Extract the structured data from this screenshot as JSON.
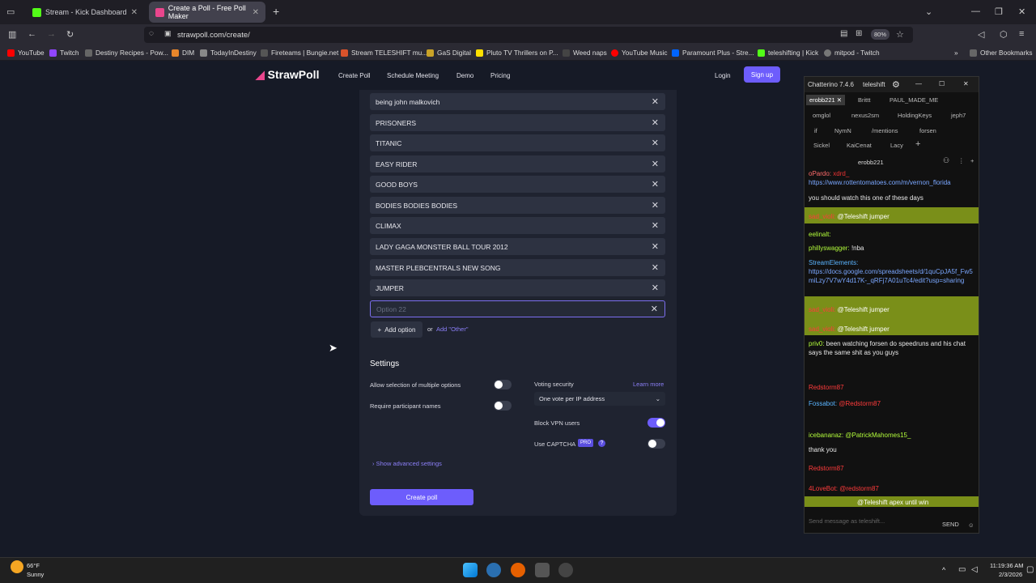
{
  "browser": {
    "tabs": [
      {
        "title": "Stream - Kick Dashboard",
        "active": false
      },
      {
        "title": "Create a Poll - Free Poll Maker",
        "active": true
      }
    ],
    "url": "strawpoll.com/create/",
    "zoom": "80%",
    "bookmarks": [
      "YouTube",
      "Twitch",
      "Destiny Recipes - Pow...",
      "DIM",
      "TodayInDestiny",
      "Fireteams | Bungie.net",
      "Stream TELESHIFT mu...",
      "GaS Digital",
      "Pluto TV Thrillers on P...",
      "Weed naps",
      "YouTube Music",
      "Paramount Plus - Stre...",
      "teleshifting | Kick",
      "mitpod - Twitch"
    ],
    "other_bookmarks": "Other Bookmarks"
  },
  "site": {
    "logo": "StrawPoll",
    "nav": [
      "Create Poll",
      "Schedule Meeting",
      "Demo",
      "Pricing"
    ],
    "login": "Login",
    "signup": "Sign up"
  },
  "poll": {
    "options": [
      "being john malkovich",
      "PRISONERS",
      "TITANIC",
      "EASY RIDER",
      "GOOD BOYS",
      "BODIES BODIES BODIES",
      "CLIMAX",
      "LADY GAGA MONSTER BALL TOUR 2012",
      "MASTER PLEBCENTRALS NEW SONG",
      "JUMPER"
    ],
    "new_option_placeholder": "Option 22",
    "add_option": "Add option",
    "or": "or",
    "add_other": "Add \"Other\""
  },
  "settings": {
    "title": "Settings",
    "multiple": "Allow selection of multiple options",
    "names": "Require participant names",
    "voting_security": "Voting security",
    "learn_more": "Learn more",
    "security_value": "One vote per IP address",
    "block_vpn": "Block VPN users",
    "captcha": "Use CAPTCHA",
    "pro": "PRO",
    "advanced": "Show advanced settings",
    "create": "Create poll"
  },
  "chat": {
    "app": "Chatterino 7.4.6",
    "user": "teleshift",
    "tabs_row1": [
      "erobb221",
      "Brittt",
      "PAUL_MADE_ME"
    ],
    "tabs_row2": [
      "omglol",
      "nexus2sm",
      "HoldingKeys",
      "jeph7"
    ],
    "tabs_row3": [
      "if",
      "NymN",
      "/mentions",
      "forsen"
    ],
    "tabs_row4": [
      "Sickel",
      "KaiCenat",
      "Lacy"
    ],
    "channel": "erobb221",
    "messages": [
      {
        "user": "oPardo:",
        "text": "xdrd_"
      },
      {
        "user": "",
        "text": "https://www.rottentomatoes.com/m/vernon_florida"
      },
      {
        "user": "",
        "text": "you should watch this one of these days"
      },
      {
        "user": "sad_violi:",
        "text": "@Teleshift jumper"
      },
      {
        "user": "eelinalt:",
        "text": ""
      },
      {
        "user": "phillyswagger:",
        "text": "!nba"
      },
      {
        "user": "StreamElements:",
        "text": "https://docs.google.com/spreadsheets/d/1quCpJA5f_Fw5miLzy7V7wY4d17K-_qRFj7A01uTc4/edit?usp=sharing"
      },
      {
        "user": "sad_violi:",
        "text": "@Teleshift jumper"
      },
      {
        "user": "sad_violi:",
        "text": "@Teleshift jumper"
      },
      {
        "user": "priv0:",
        "text": "been watching forsen do speedruns and his chat says the same shit as you guys"
      },
      {
        "user": "Redstorm87",
        "text": ""
      },
      {
        "user": "Fossabot:",
        "text": "@Redstorm87"
      },
      {
        "user": "icebananaz:",
        "text": "@PatrickMahomes15_"
      },
      {
        "user": "",
        "text": "thank you"
      },
      {
        "user": "Redstorm87",
        "text": ""
      },
      {
        "user": "4LoveBot:",
        "text": "@redstorm87"
      },
      {
        "user": "",
        "text": "@Teleshift apex until win"
      }
    ],
    "input_placeholder": "Send message as teleshift...",
    "send": "SEND"
  },
  "taskbar": {
    "weather_temp": "66°F",
    "weather_desc": "Sunny",
    "time": "11:19:36 AM",
    "date": "2/3/2026"
  }
}
